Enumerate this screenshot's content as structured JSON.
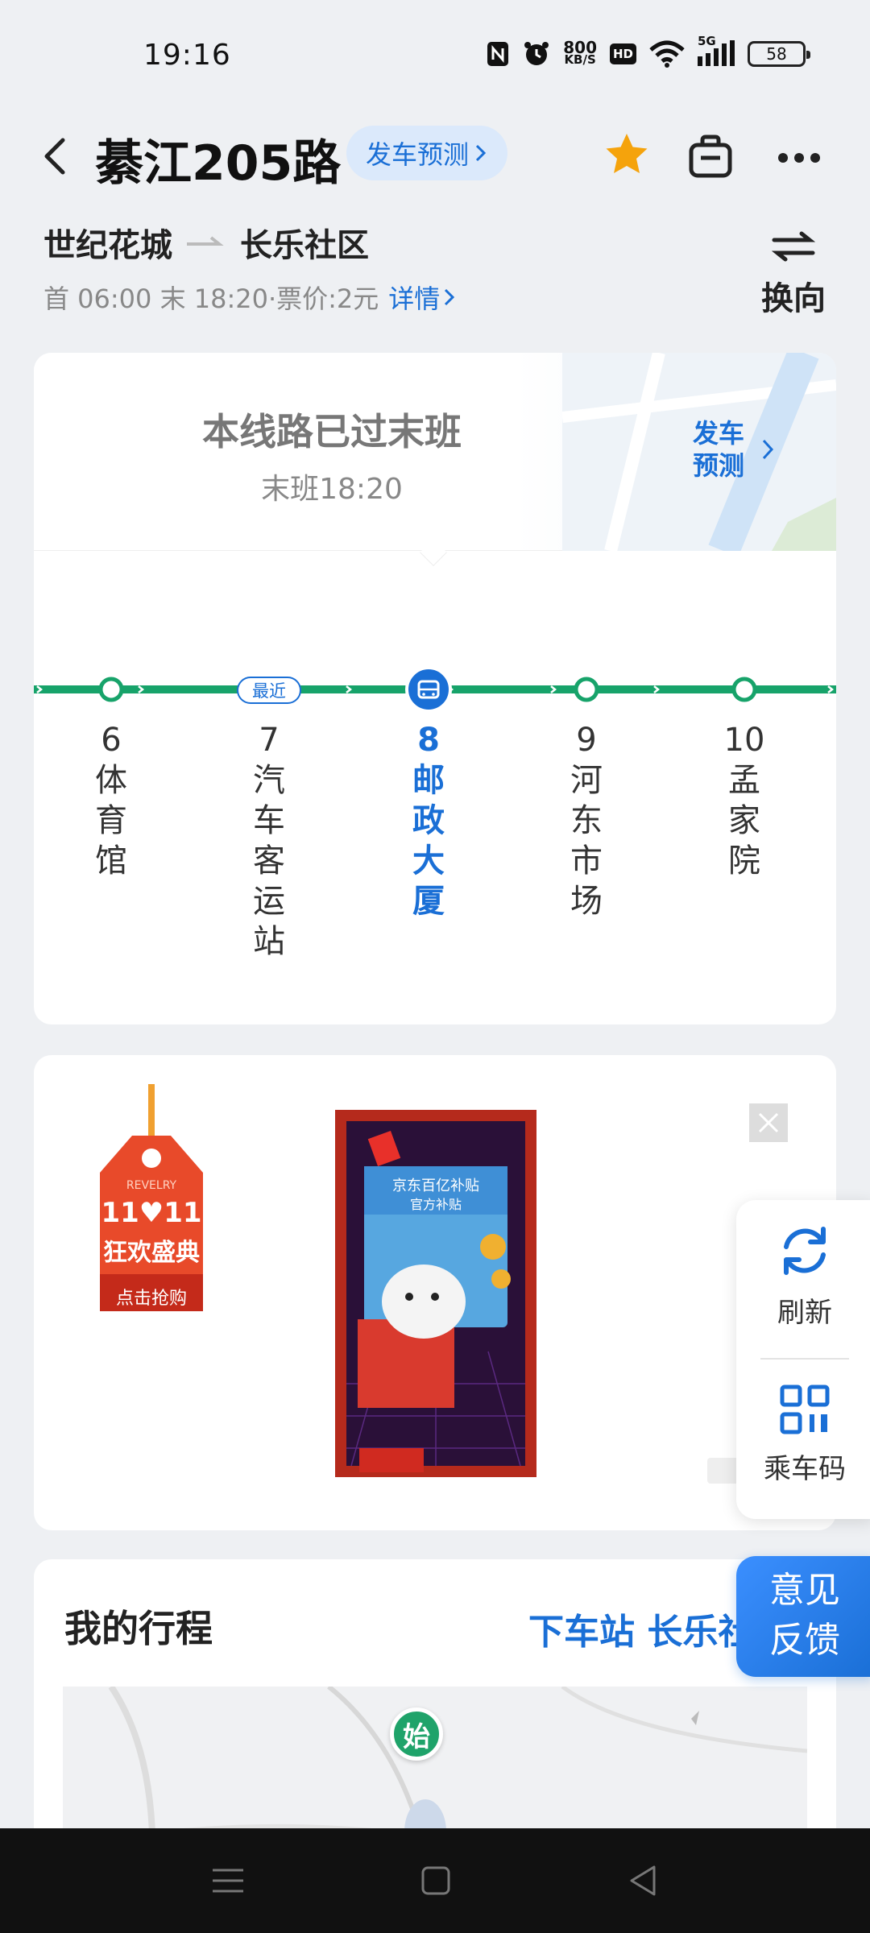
{
  "status_bar": {
    "time": "19:16",
    "net_speed_top": "800",
    "net_speed_bottom": "KB/S",
    "hd": "HD",
    "signal": "5G",
    "battery": "58"
  },
  "header": {
    "title": "綦江205路",
    "predict_label": "发车预测",
    "icons": [
      "back-icon",
      "star-icon",
      "bag-icon",
      "more-icon"
    ],
    "star_color": "#f5a30c"
  },
  "route": {
    "from": "世纪花城",
    "to": "长乐社区",
    "info": "首 06:00 末 18:20·票价:2元",
    "details_label": "详情",
    "swap_label": "换向"
  },
  "line_card": {
    "status": "本线路已过末班",
    "last_bus": "末班18:20",
    "predict_line1": "发车",
    "predict_line2": "预测",
    "nearest_badge": "最近",
    "line_color": "#17a36a",
    "stops": [
      {
        "num": "6",
        "name": "体\n育\n馆"
      },
      {
        "num": "7",
        "name": "汽\n车\n客\n运\n站"
      },
      {
        "num": "8",
        "name": "邮\n政\n大\n厦"
      },
      {
        "num": "9",
        "name": "河\n东\n市\n场"
      },
      {
        "num": "10",
        "name": "孟\n家\n院"
      }
    ]
  },
  "ad": {
    "tag_top": "REVELRY",
    "tag_date": "11♥11",
    "tag_main": "狂欢盛典",
    "tag_button": "点击抢购",
    "banner_line1": "京东百亿补贴",
    "banner_line2": "官方补贴"
  },
  "side_panel": {
    "refresh_label": "刷新",
    "ride_code_label": "乘车码",
    "feedback_line1": "意见",
    "feedback_line2": "反馈"
  },
  "trip": {
    "title": "我的行程",
    "destination": "下车站 长乐社区",
    "start_pin": "始"
  }
}
